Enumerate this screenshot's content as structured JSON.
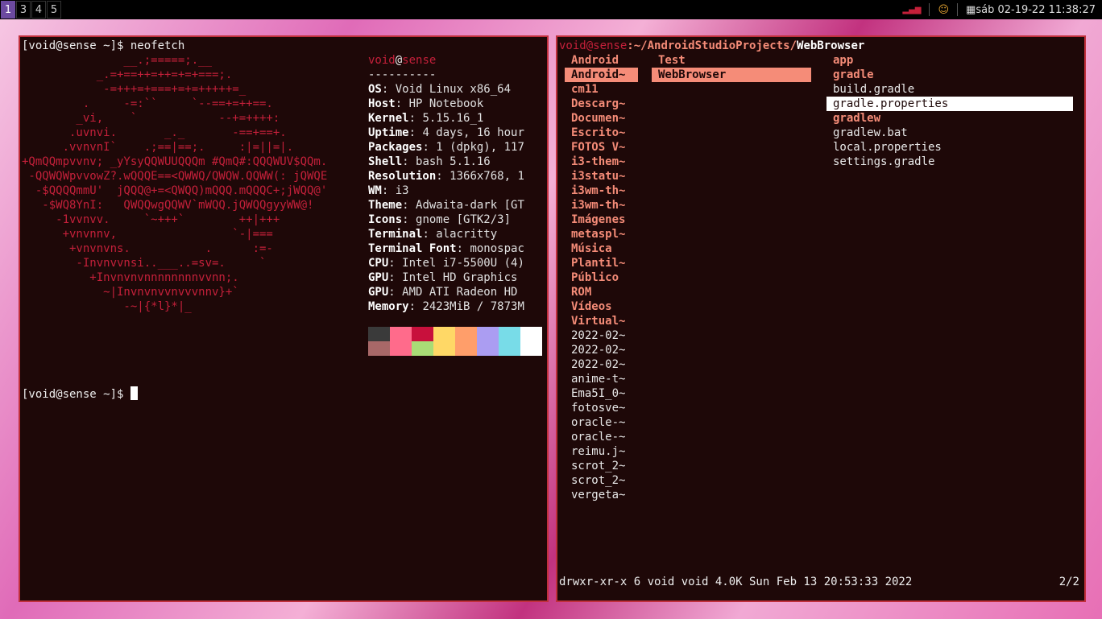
{
  "topbar": {
    "workspaces": [
      "1",
      "3",
      "4",
      "5"
    ],
    "active_workspace": "1",
    "clock": "sáb 02-19-22 11:38:27"
  },
  "left_term": {
    "prompt1": "[void@sense ~]$ neofetch",
    "logo_lines": [
      "               __.;=====;.__",
      "           _.=+==++=++=+=+===;.",
      "            -=+++=+===+=+=+++++=_",
      "         .     -=:``     `--==+=++==.",
      "        _vi,    `            --+=++++:",
      "       .uvnvi.       _._       -==+==+.",
      "      .vvnvnI`    .;==|==;.     :|=||=|.",
      "+QmQQmpvvnv; _yYsyQQWUUQQQm #QmQ#:QQQWUV$QQm.",
      " -QQWQWpvvowZ?.wQQQE==<QWWQ/QWQW.QQWW(: jQWQE",
      "  -$QQQQmmU'  jQQQ@+=<QWQQ)mQQQ.mQQQC+;jWQQ@'",
      "   -$WQ8YnI:   QWQQwgQQWV`mWQQ.jQWQQgyyWW@!",
      "     -1vvnvv.     `~+++`        ++|+++",
      "      +vnvnnv,                 `-|===",
      "       +vnvnvns.           .      :=-",
      "        -Invnvvnsi..___..=sv=.     `",
      "          +Invnvnvnnnnnnnnvvnn;.",
      "            ~|Invnvnvvnvvvnnv}+`",
      "               -~|{*l}*|_"
    ],
    "user": "void",
    "at": "@",
    "host": "sense",
    "separator": "----------",
    "info": [
      {
        "key": "OS",
        "value": "Void Linux x86_64"
      },
      {
        "key": "Host",
        "value": "HP Notebook"
      },
      {
        "key": "Kernel",
        "value": "5.15.16_1"
      },
      {
        "key": "Uptime",
        "value": "4 days, 16 hour"
      },
      {
        "key": "Packages",
        "value": "1 (dpkg), 117"
      },
      {
        "key": "Shell",
        "value": "bash 5.1.16"
      },
      {
        "key": "Resolution",
        "value": "1366x768, 1"
      },
      {
        "key": "WM",
        "value": "i3"
      },
      {
        "key": "Theme",
        "value": "Adwaita-dark [GT"
      },
      {
        "key": "Icons",
        "value": "gnome [GTK2/3]"
      },
      {
        "key": "Terminal",
        "value": "alacritty"
      },
      {
        "key": "Terminal Font",
        "value": "monospac"
      },
      {
        "key": "CPU",
        "value": "Intel i7-5500U (4)"
      },
      {
        "key": "GPU",
        "value": "Intel HD Graphics"
      },
      {
        "key": "GPU",
        "value": "AMD ATI Radeon HD"
      },
      {
        "key": "Memory",
        "value": "2423MiB / 7873M"
      }
    ],
    "colors_top": [
      "#3a3a3a",
      "#ff6b8b",
      "#c8103c",
      "#ffd866",
      "#ff9e6a",
      "#ab9df2",
      "#78dce8",
      "#ffffff"
    ],
    "colors_bottom": [
      "#a86868",
      "#ff6b8b",
      "#a9dc76",
      "#ffd866",
      "#ff9e6a",
      "#ab9df2",
      "#78dce8",
      "#ffffff"
    ],
    "prompt2": "[void@sense ~]$ "
  },
  "right_term": {
    "path_user": "void@sense",
    "path_dir": ":~/AndroidStudioProjects/",
    "path_current": "WebBrowser",
    "col1": [
      {
        "name": "Android",
        "type": "dir"
      },
      {
        "name": "Android~",
        "type": "dir",
        "selected": true
      },
      {
        "name": "cm11",
        "type": "dir"
      },
      {
        "name": "Descarg~",
        "type": "dir"
      },
      {
        "name": "Documen~",
        "type": "dir"
      },
      {
        "name": "Escrito~",
        "type": "dir"
      },
      {
        "name": "FOTOS V~",
        "type": "dir"
      },
      {
        "name": "i3-them~",
        "type": "dir"
      },
      {
        "name": "i3statu~",
        "type": "dir"
      },
      {
        "name": "i3wm-th~",
        "type": "dir"
      },
      {
        "name": "i3wm-th~",
        "type": "dir"
      },
      {
        "name": "Imágenes",
        "type": "dir"
      },
      {
        "name": "metaspl~",
        "type": "dir"
      },
      {
        "name": "Música",
        "type": "dir"
      },
      {
        "name": "Plantil~",
        "type": "dir"
      },
      {
        "name": "Público",
        "type": "dir"
      },
      {
        "name": "ROM",
        "type": "dir"
      },
      {
        "name": "Vídeos",
        "type": "dir"
      },
      {
        "name": "Virtual~",
        "type": "dir"
      },
      {
        "name": "2022-02~",
        "type": "file"
      },
      {
        "name": "2022-02~",
        "type": "file"
      },
      {
        "name": "2022-02~",
        "type": "file"
      },
      {
        "name": "anime-t~",
        "type": "file"
      },
      {
        "name": "Ema5I_0~",
        "type": "file"
      },
      {
        "name": "fotosve~",
        "type": "file"
      },
      {
        "name": "oracle-~",
        "type": "file"
      },
      {
        "name": "oracle-~",
        "type": "file"
      },
      {
        "name": "reimu.j~",
        "type": "file"
      },
      {
        "name": "scrot_2~",
        "type": "file"
      },
      {
        "name": "scrot_2~",
        "type": "file"
      },
      {
        "name": "vergeta~",
        "type": "file"
      }
    ],
    "col2": [
      {
        "name": "Test",
        "type": "dir"
      },
      {
        "name": "WebBrowser",
        "type": "dir",
        "selected": true
      }
    ],
    "col3": [
      {
        "name": "app",
        "type": "dir"
      },
      {
        "name": "gradle",
        "type": "dir"
      },
      {
        "name": "build.gradle",
        "type": "file"
      },
      {
        "name": "gradle.properties",
        "type": "file",
        "selected": true
      },
      {
        "name": "gradlew",
        "type": "dir"
      },
      {
        "name": "gradlew.bat",
        "type": "file"
      },
      {
        "name": "local.properties",
        "type": "file"
      },
      {
        "name": "settings.gradle",
        "type": "file"
      }
    ],
    "status": "drwxr-xr-x 6 void void 4.0K Sun Feb 13 20:53:33 2022",
    "position": "2/2"
  }
}
